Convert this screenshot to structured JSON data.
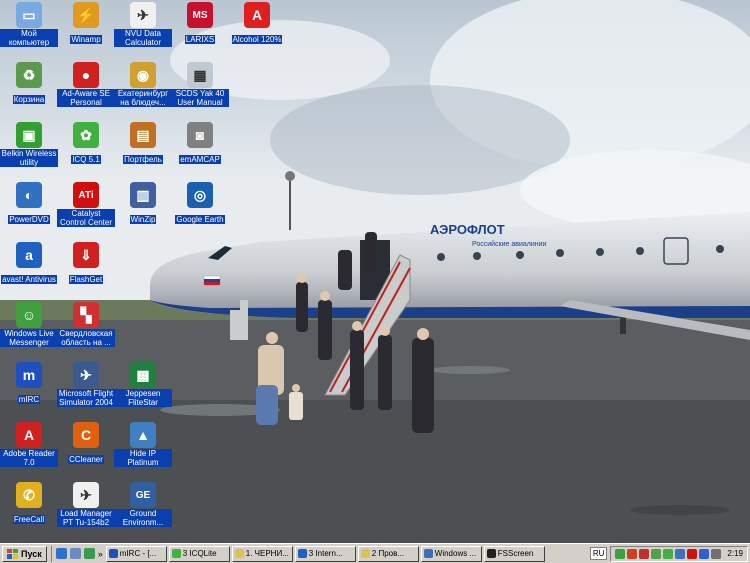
{
  "desktop": {
    "icons": [
      {
        "label": "Мой компьютер",
        "icon": "my-computer-icon",
        "color": "#7aa8e0",
        "glyph": "▭"
      },
      {
        "label": "Winamp",
        "icon": "winamp-icon",
        "color": "#e09a20",
        "glyph": "⚡"
      },
      {
        "label": "NVU Data Calculator",
        "icon": "nvu-calculator-icon",
        "color": "#f0f0f0",
        "glyph": "✈"
      },
      {
        "label": "LARIXS",
        "icon": "larixs-icon",
        "color": "#c8102e",
        "glyph": "MS"
      },
      {
        "label": "Alcohol 120%",
        "icon": "alcohol-icon",
        "color": "#e02020",
        "glyph": "A"
      },
      {
        "label": "Корзина",
        "icon": "recycle-bin-icon",
        "color": "#5a9a4a",
        "glyph": "♻"
      },
      {
        "label": "Ad-Aware SE Personal",
        "icon": "ad-aware-icon",
        "color": "#d02020",
        "glyph": "●"
      },
      {
        "label": "Екатеринбург на блюдеч...",
        "icon": "globe-icon",
        "color": "#d0a030",
        "glyph": "◉"
      },
      {
        "label": "SCDS Yak 40 User Manual",
        "icon": "manual-icon",
        "color": "#c0c8d0",
        "glyph": "▦"
      },
      {
        "label": "Belkin Wireless utility",
        "icon": "wireless-icon",
        "color": "#30a030",
        "glyph": "▣"
      },
      {
        "label": "ICQ 5.1",
        "icon": "icq-icon",
        "color": "#40b040",
        "glyph": "✿"
      },
      {
        "label": "Портфель",
        "icon": "briefcase-icon",
        "color": "#c07020",
        "glyph": "▤"
      },
      {
        "label": "emAMCAP",
        "icon": "camera-icon",
        "color": "#808080",
        "glyph": "◙"
      },
      {
        "label": "PowerDVD",
        "icon": "powerdvd-icon",
        "color": "#3070c0",
        "glyph": "◐"
      },
      {
        "label": "Catalyst Control Center",
        "icon": "ati-icon",
        "color": "#d01010",
        "glyph": "ATi"
      },
      {
        "label": "WinZip",
        "icon": "winzip-icon",
        "color": "#4060a0",
        "glyph": "▥"
      },
      {
        "label": "Google Earth",
        "icon": "google-earth-icon",
        "color": "#1a5fb0",
        "glyph": "◎"
      },
      {
        "label": "avast! Antivirus",
        "icon": "avast-icon",
        "color": "#2060c0",
        "glyph": "a"
      },
      {
        "label": "FlashGet",
        "icon": "flashget-icon",
        "color": "#d02020",
        "glyph": "⇓"
      },
      {
        "label": "Windows Live Messenger",
        "icon": "messenger-icon",
        "color": "#40a040",
        "glyph": "☺"
      },
      {
        "label": "Свердловская область на ...",
        "icon": "map-icon",
        "color": "#d03030",
        "glyph": "▚"
      },
      {
        "label": "mIRC",
        "icon": "mirc-icon",
        "color": "#2050c0",
        "glyph": "m"
      },
      {
        "label": "Microsoft Flight Simulator 2004",
        "icon": "flight-simulator-icon",
        "color": "#3a5a90",
        "glyph": "✈"
      },
      {
        "label": "Jeppesen FliteStar",
        "icon": "jeppesen-icon",
        "color": "#208040",
        "glyph": "▩"
      },
      {
        "label": "Adobe Reader 7.0",
        "icon": "adobe-reader-icon",
        "color": "#d02020",
        "glyph": "A"
      },
      {
        "label": "CCleaner",
        "icon": "ccleaner-icon",
        "color": "#e06010",
        "glyph": "C"
      },
      {
        "label": "Hide IP Platinum",
        "icon": "hide-ip-icon",
        "color": "#4080c0",
        "glyph": "▲"
      },
      {
        "label": "FreeCall",
        "icon": "phone-icon",
        "color": "#e0b020",
        "glyph": "✆"
      },
      {
        "label": "Load Manager PT Tu-154b2",
        "icon": "load-manager-icon",
        "color": "#f0f0f0",
        "glyph": "✈"
      },
      {
        "label": "Ground Environm...",
        "icon": "ground-environment-icon",
        "color": "#3060a0",
        "glyph": "GE"
      }
    ]
  },
  "wallpaper": {
    "airline_name": "АЭРОФЛОТ",
    "airline_subtitle": "Российские авиалинии"
  },
  "taskbar": {
    "start_label": "Пуск",
    "more_chevron": "»",
    "tasks": [
      {
        "label": "mIRC - [...",
        "icon": "mirc-icon",
        "color": "#2050c0"
      },
      {
        "label": "3 ICQLite",
        "icon": "icq-icon",
        "color": "#40b040"
      },
      {
        "label": "1. ЧЕРНИ...",
        "icon": "folder-icon",
        "color": "#e0c050"
      },
      {
        "label": "3 Intern...",
        "icon": "ie-icon",
        "color": "#2060c0"
      },
      {
        "label": "2 Пров...",
        "icon": "folder-icon",
        "color": "#e0c050"
      },
      {
        "label": "Windows ...",
        "icon": "windows-icon",
        "color": "#3a6fc0"
      },
      {
        "label": "FSScreen",
        "icon": "fsscreen-icon",
        "color": "#202020"
      }
    ],
    "language": "RU",
    "clock": "2:19"
  },
  "colors": {
    "taskbar_bg": "#d4d0c8",
    "icon_label_bg": "#0a3fb0"
  }
}
